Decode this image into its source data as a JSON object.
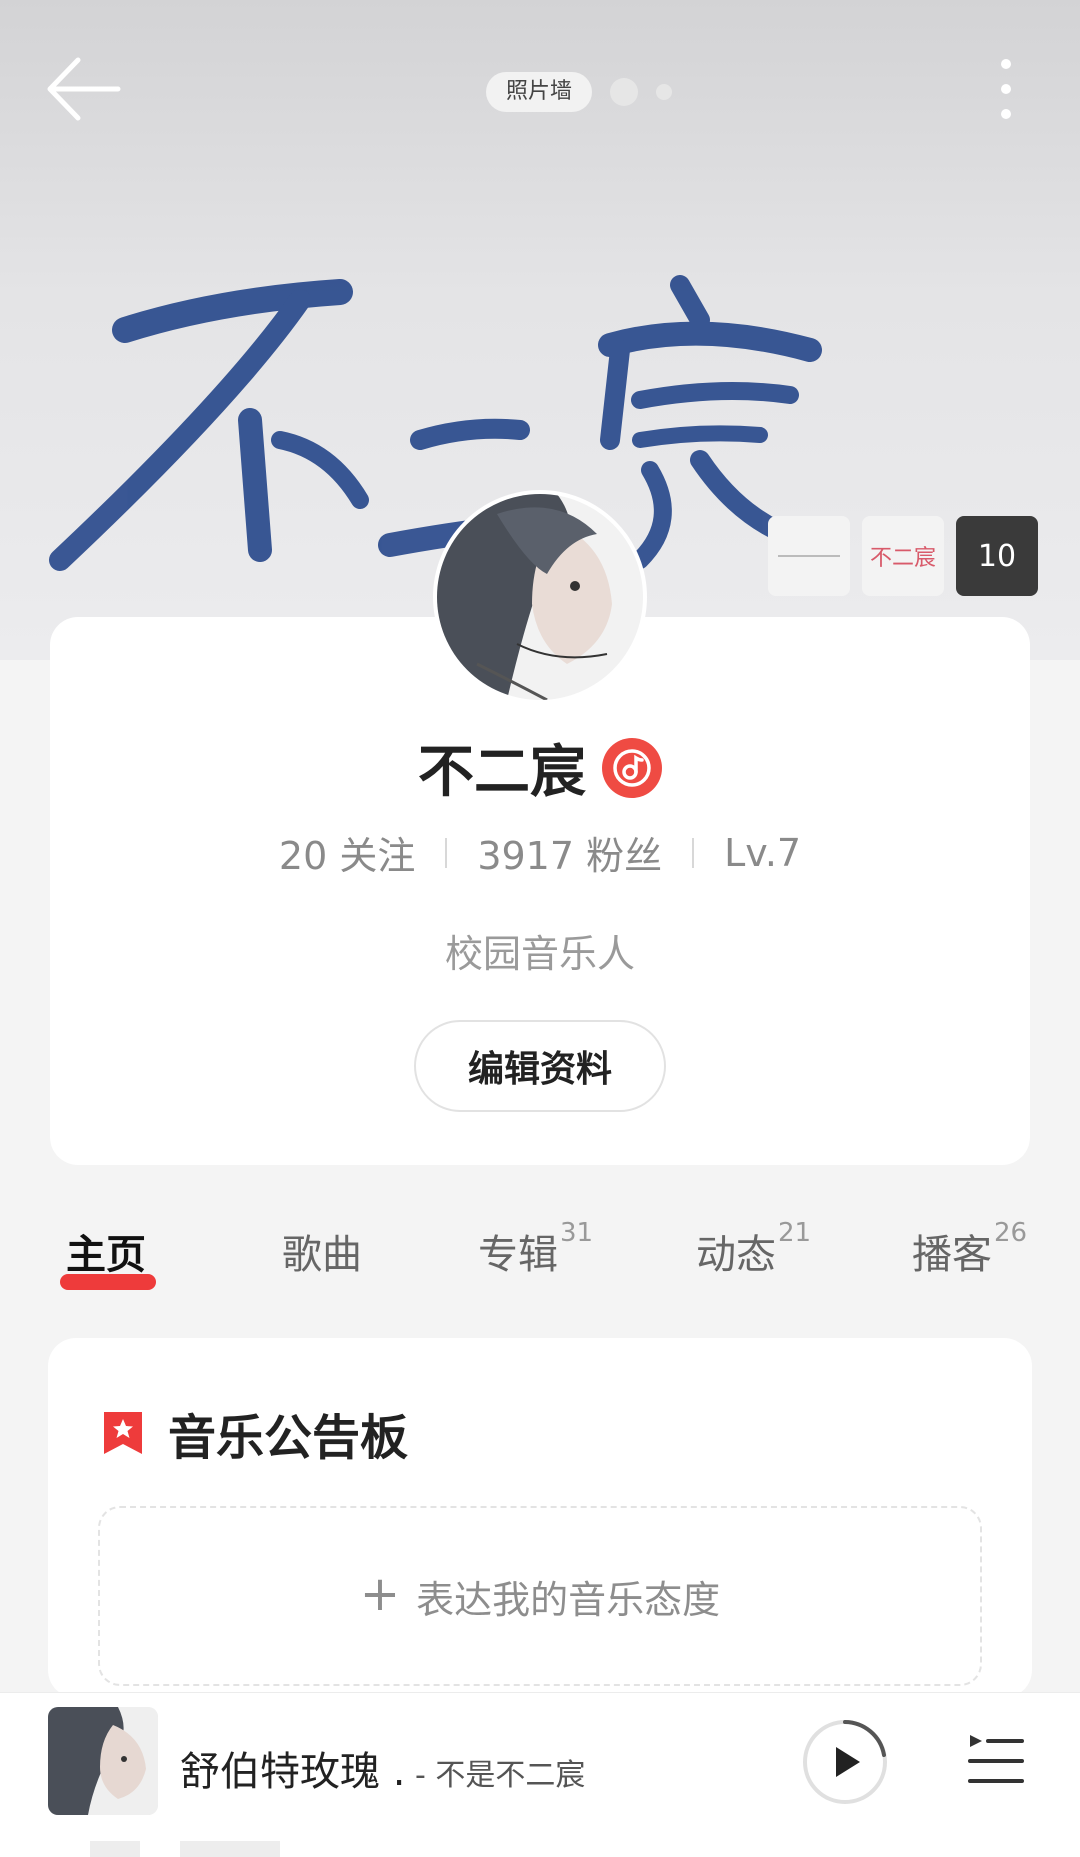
{
  "header": {
    "photo_wall_label": "照片墙",
    "photo_count": "10",
    "thumb_logo_text": "不二宸"
  },
  "profile": {
    "name": "不二宸",
    "following": "20 关注",
    "followers": "3917 粉丝",
    "level": "Lv.7",
    "bio": "校园音乐人",
    "edit_label": "编辑资料"
  },
  "tabs": [
    {
      "label": "主页",
      "count": ""
    },
    {
      "label": "歌曲",
      "count": ""
    },
    {
      "label": "专辑",
      "count": "31"
    },
    {
      "label": "动态",
      "count": "21"
    },
    {
      "label": "播客",
      "count": "26"
    }
  ],
  "board": {
    "title": "音乐公告板",
    "add_label": "表达我的音乐态度"
  },
  "player": {
    "song": "舒伯特玫瑰 .",
    "artist": " - 不是不二宸"
  },
  "colors": {
    "accent": "#ee3b3b",
    "brush_blue": "#2a4a8c"
  }
}
